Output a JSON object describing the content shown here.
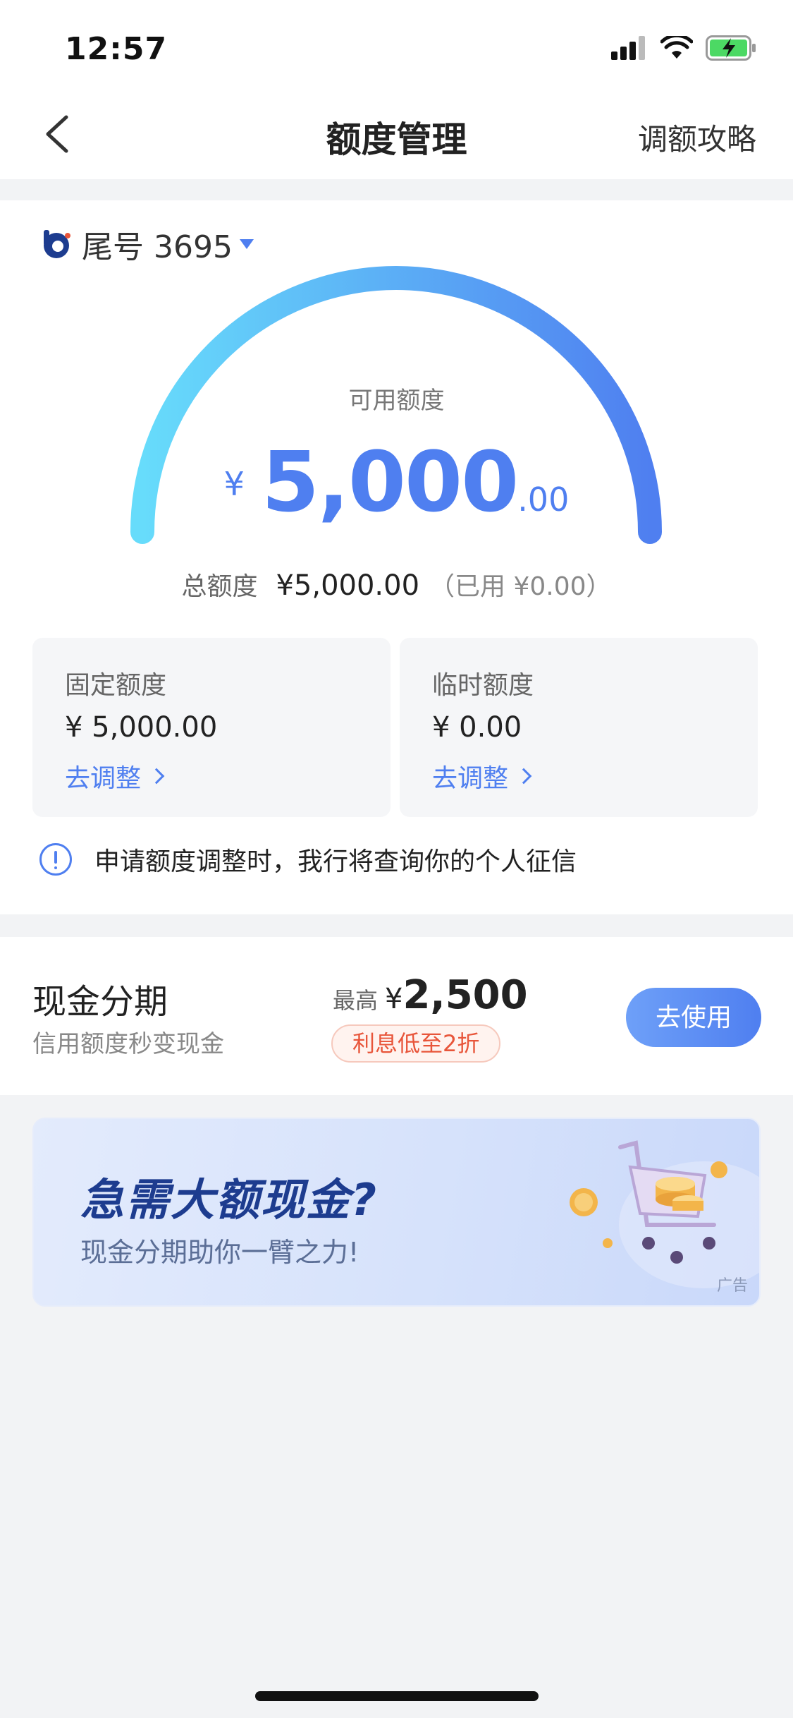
{
  "status_bar": {
    "time": "12:57"
  },
  "nav": {
    "title": "额度管理",
    "right_link": "调额攻略"
  },
  "account": {
    "label": "尾号 3695"
  },
  "gauge": {
    "label": "可用额度",
    "currency": "¥",
    "amount_int": "5,000",
    "amount_dec": ".00",
    "available_fraction": 1.0
  },
  "total": {
    "label": "总额度",
    "value": "¥5,000.00",
    "used": "（已用 ¥0.00）"
  },
  "fixed_limit": {
    "title": "固定额度",
    "value": "¥ 5,000.00",
    "link": "去调整"
  },
  "temp_limit": {
    "title": "临时额度",
    "value": "¥ 0.00",
    "link": "去调整"
  },
  "notice": {
    "text": "申请额度调整时，我行将查询你的个人征信"
  },
  "cash_installment": {
    "title": "现金分期",
    "subtitle": "信用额度秒变现金",
    "max_label": "最高",
    "max_currency": "¥",
    "max_value": "2,500",
    "tag": "利息低至2折",
    "button": "去使用"
  },
  "banner": {
    "title": "急需大额现金?",
    "subtitle": "现金分期助你一臂之力!",
    "ad_label": "广告"
  },
  "colors": {
    "accent": "#4f7ff0",
    "gauge_start": "#67dcfb",
    "gauge_end": "#4f7ff0",
    "tag_red": "#e8553a"
  }
}
